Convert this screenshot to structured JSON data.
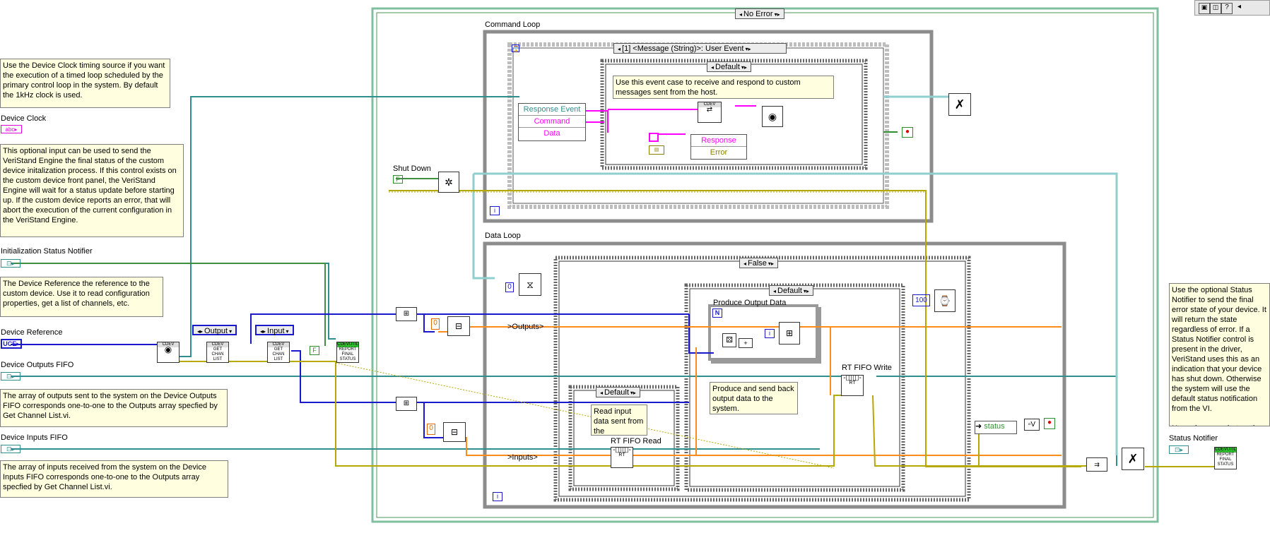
{
  "toolbar": {
    "buttons": [
      "lock-icon",
      "unlock-icon",
      "help-icon"
    ],
    "scroll": "◂"
  },
  "case_selectors": {
    "error_case": "No Error",
    "event_case": "[1] <Message (String)>: User Event",
    "message_case": "Default",
    "data_case": "False",
    "produce_case": "Default",
    "read_case": "Default"
  },
  "loop_labels": {
    "command": "Command Loop",
    "data": "Data Loop"
  },
  "notes": {
    "device_clock": "Use the Device Clock timing source if you want the execution of a timed loop scheduled by the primary control loop in the system. By default the 1kHz clock is used.",
    "init_status": "This optional input can be used to send the VeriStand Engine the final status of the custom device initalization process. If this control exists on the custom device front panel, the VeriStand Engine will wait for a status update before starting up. If the custom device reports an error, that will abort the execution of the current configuration in the VeriStand Engine.",
    "device_reference": "The Device Reference the reference to the custom device. Use it to read configuration properties, get a list of channels, etc.",
    "outputs_fifo": "The array of outputs sent to the system on the Device Outputs FIFO corresponds one-to-one to the Outputs array specfied by Get Channel List.vi.",
    "inputs_fifo": "The array of inputs  received from the system on the Device Inputs FIFO corresponds one-to-one to the Outputs array specfied by Get Channel List.vi.",
    "event_case": "Use this event case to receive and respond to custom messages sent from the host.",
    "read_input": "Read input data sent from the",
    "produce_send": "Produce and send back output data to the system.",
    "status_notifier": "Use the optional Status Notifier to send the final error state of your device. It will return the state regardless of error. If a Status Notifier control is present in the driver, VeriStand uses this as an indication that your device has shut down. Otherwise the system will use the default status notification from the VI.\n\nNormal errors, shut as the device system shuts down a FIFO will be forced to close, should not be reported; the Report Final Error Status VI handles this automatically."
  },
  "terminals": {
    "device_clock": "Device Clock",
    "init_status_notifier": "Initialization Status Notifier",
    "device_reference": "Device Reference",
    "device_outputs_fifo": "Device Outputs FIFO",
    "device_inputs_fifo": "Device Inputs FIFO",
    "shut_down": "Shut Down",
    "status_notifier": "Status Notifier"
  },
  "rings": {
    "output": "Output",
    "input": "Input"
  },
  "event_data": [
    "Response Event",
    "Command",
    "Data"
  ],
  "unbundle": [
    "Response",
    "Error"
  ],
  "node_labels": {
    "produce_output": "Produce Output Data",
    "rt_fifo_write": "RT FIFO Write",
    "rt_fifo_read": "RT FIFO Read",
    "status": "status",
    "outputs_tunnel": ">Outputs>",
    "inputs_tunnel": ">Inputs>"
  },
  "constants": {
    "zero": "0",
    "hundred": "100",
    "false_const": "F",
    "n": "N",
    "i": "i"
  },
  "subvi_text": {
    "cdev": "CDEV",
    "get_chan_list": "GET CHAN LIST",
    "report_final_status": "REPORT FINAL STATUS",
    "cdevutil": "CDEVUTIL",
    "rt": "RT"
  },
  "colors": {
    "error": "#b5a800",
    "refnum": "#007f7f",
    "orange": "#ff7f00",
    "blue": "#0000cc",
    "pink": "#ff00ff",
    "loop_green": "#4a9a5a"
  }
}
